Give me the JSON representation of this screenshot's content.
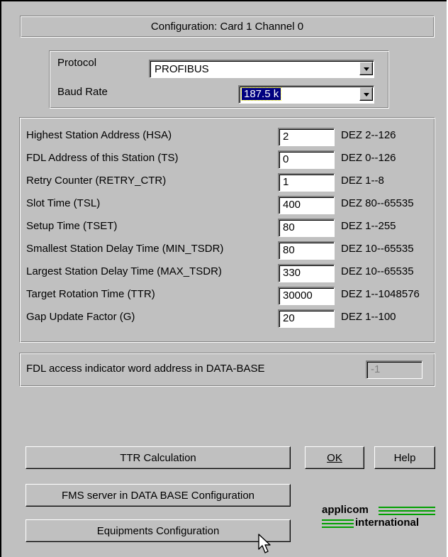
{
  "header": {
    "title": "Configuration: Card 1  Channel 0"
  },
  "protocol": {
    "label": "Protocol",
    "value": "PROFIBUS",
    "baud_label": "Baud Rate",
    "baud_value": "187.5 k"
  },
  "params": [
    {
      "label": "Highest Station Address (HSA)",
      "value": "2",
      "range": "DEZ 2--126"
    },
    {
      "label": "FDL Address of this Station (TS)",
      "value": "0",
      "range": "DEZ 0--126"
    },
    {
      "label": "Retry Counter (RETRY_CTR)",
      "value": "1",
      "range": "DEZ 1--8"
    },
    {
      "label": "Slot Time (TSL)",
      "value": "400",
      "range": "DEZ 80--65535"
    },
    {
      "label": "Setup Time (TSET)",
      "value": "80",
      "range": "DEZ 1--255"
    },
    {
      "label": "Smallest Station Delay Time (MIN_TSDR)",
      "value": "80",
      "range": "DEZ 10--65535"
    },
    {
      "label": "Largest Station Delay Time (MAX_TSDR)",
      "value": "330",
      "range": "DEZ 10--65535"
    },
    {
      "label": "Target Rotation Time (TTR)",
      "value": "30000",
      "range": "DEZ 1--1048576"
    },
    {
      "label": "Gap Update Factor (G)",
      "value": "20",
      "range": "DEZ 1--100"
    }
  ],
  "fdl": {
    "label": "FDL access indicator word address in DATA-BASE",
    "value": "-1"
  },
  "buttons": {
    "ttr": "TTR Calculation",
    "ok": "OK",
    "help": "Help",
    "fms": "FMS server in DATA BASE Configuration",
    "equipments": "Equipments Configuration"
  },
  "logo": {
    "line1": "applicom",
    "line2": "international",
    "color": "#00a000"
  },
  "colors": {
    "dialog_bg": "#c0c0c0",
    "selection": "#000080"
  },
  "icons": {
    "cursor": "mouse-pointer-icon"
  }
}
